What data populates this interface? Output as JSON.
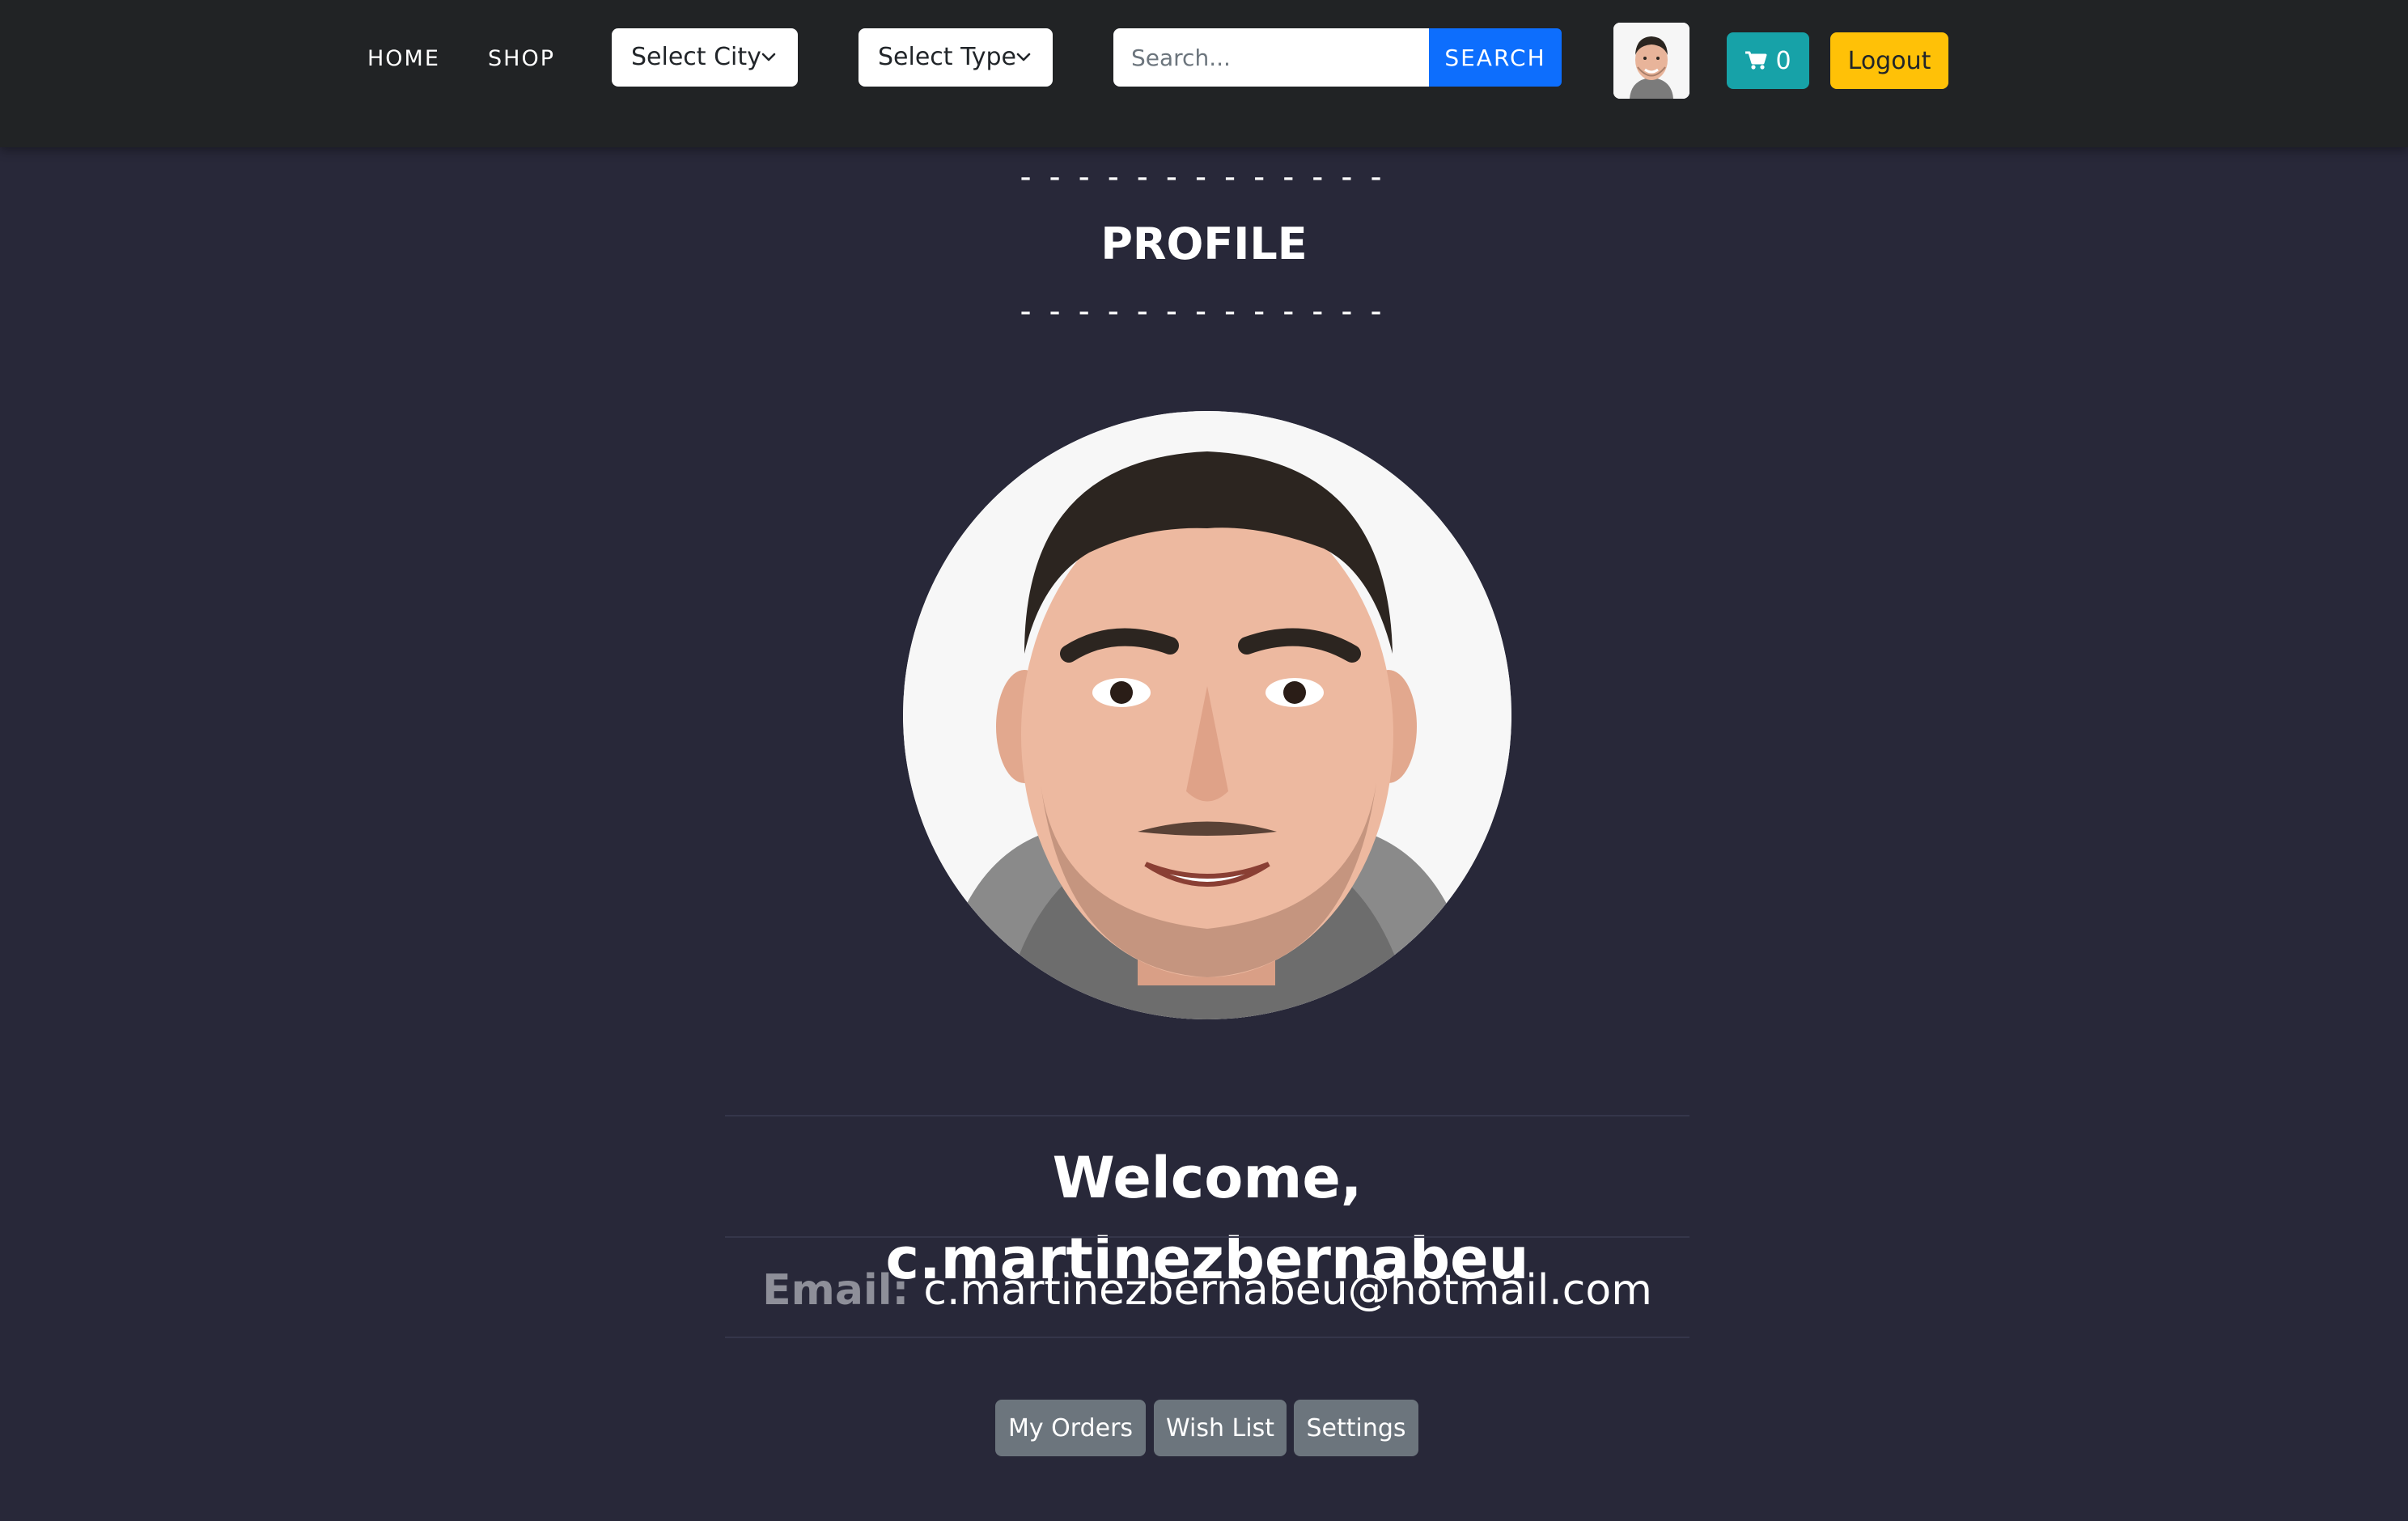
{
  "nav": {
    "home": "HOME",
    "shop": "SHOP",
    "city_select": "Select City",
    "type_select": "Select Type",
    "search_placeholder": "Search...",
    "search_button": "SEARCH",
    "cart_count": "0",
    "logout": "Logout"
  },
  "profile": {
    "dashes_top": "-------------",
    "title": "PROFILE",
    "dashes_bottom": "-------------",
    "welcome": "Welcome, c.martinezbernabeu",
    "email_label": "Email:",
    "email_value": "c.martinezbernabeu@hotmail.com"
  },
  "actions": {
    "orders": "My Orders",
    "wishlist": "Wish List",
    "settings": "Settings"
  },
  "colors": {
    "background": "#282839",
    "navbar": "#212325",
    "search_button": "#0d6efd",
    "cart_button": "#17a2a8",
    "logout_button": "#ffc107",
    "action_button": "#6c757d"
  },
  "icons": {
    "cart": "shopping-cart-icon",
    "dropdown": "chevron-down-icon"
  }
}
